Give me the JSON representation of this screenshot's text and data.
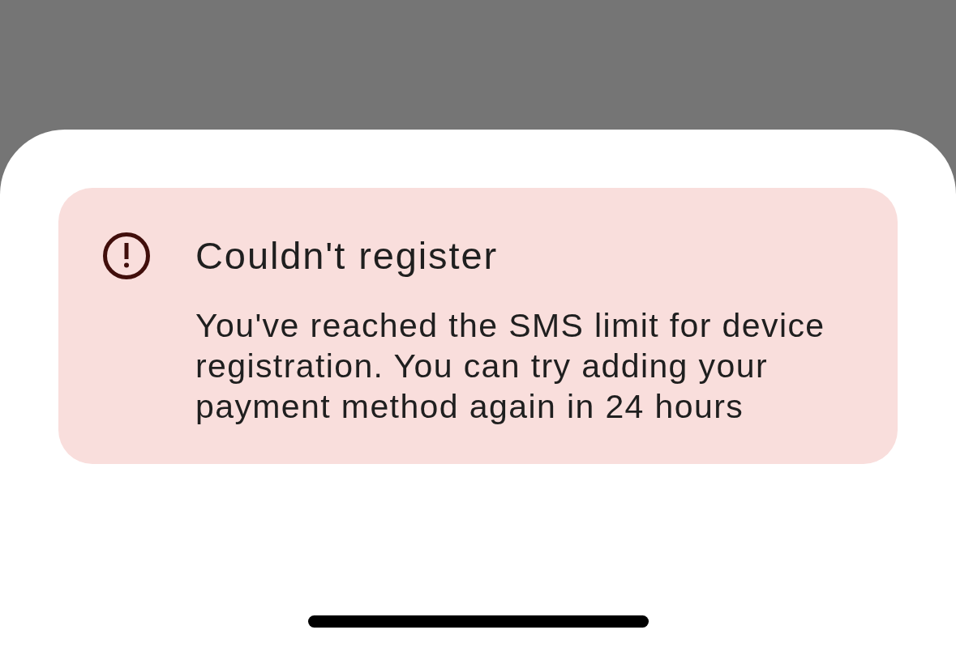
{
  "alert": {
    "kind": "error",
    "title": "Couldn't register",
    "message": "You've reached the SMS limit for device registration. You can try adding your payment method again in 24 hours"
  }
}
